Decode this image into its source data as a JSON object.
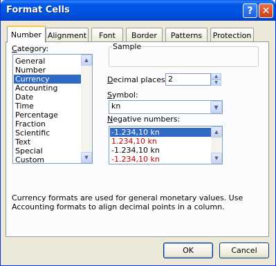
{
  "window": {
    "title": "Format Cells",
    "help_label": "?",
    "close_label": "✕"
  },
  "tabs": [
    {
      "label": "Number"
    },
    {
      "label": "Alignment"
    },
    {
      "label": "Font"
    },
    {
      "label": "Border"
    },
    {
      "label": "Patterns"
    },
    {
      "label": "Protection"
    }
  ],
  "category": {
    "label_key": "C",
    "label_rest": "ategory:",
    "selected": "Currency",
    "items": [
      "General",
      "Number",
      "Currency",
      "Accounting",
      "Date",
      "Time",
      "Percentage",
      "Fraction",
      "Scientific",
      "Text",
      "Special",
      "Custom"
    ]
  },
  "sample": {
    "label": "Sample"
  },
  "decimal_places": {
    "label_key": "D",
    "label_rest": "ecimal places:",
    "value": "2"
  },
  "symbol": {
    "label_key": "S",
    "label_rest": "ymbol:",
    "value": "kn"
  },
  "negative_numbers": {
    "label_key": "N",
    "label_rest": "egative numbers:",
    "items": [
      {
        "text": "-1.234,10 kn",
        "selected": true,
        "color": "#000000"
      },
      {
        "text": "1.234,10 kn",
        "selected": false,
        "color": "#c00000"
      },
      {
        "text": "-1.234,10 kn",
        "selected": false,
        "color": "#000000"
      },
      {
        "text": "-1.234,10 kn",
        "selected": false,
        "color": "#c00000"
      }
    ]
  },
  "description": "Currency formats are used for general monetary values.  Use Accounting formats to align decimal points in a column.",
  "buttons": {
    "ok": "OK",
    "cancel": "Cancel"
  },
  "colors": {
    "title_bar": "#0054e3",
    "selection": "#316ac5",
    "negative_red": "#c00000",
    "active_tab_accent": "#ffc83c"
  }
}
